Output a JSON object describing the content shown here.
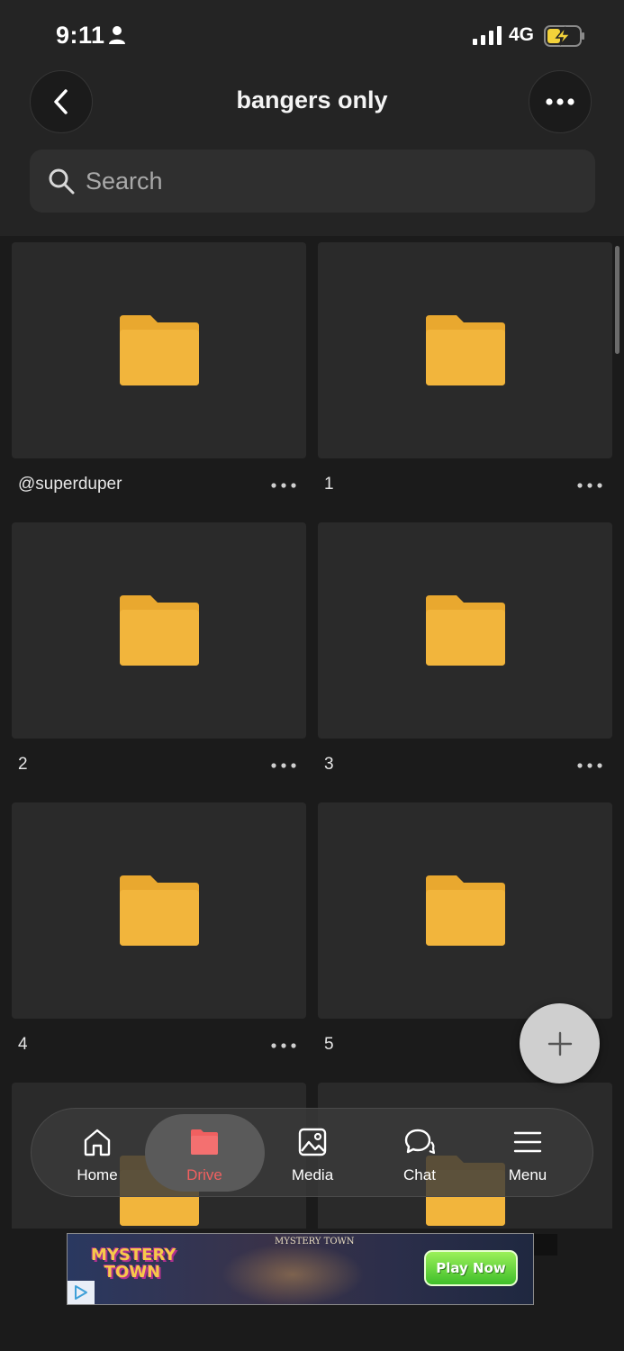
{
  "status_bar": {
    "time": "9:11",
    "network": "4G"
  },
  "header": {
    "title": "bangers only"
  },
  "search": {
    "placeholder": "Search"
  },
  "folders": [
    {
      "name": "@superduper"
    },
    {
      "name": "1"
    },
    {
      "name": "2"
    },
    {
      "name": "3"
    },
    {
      "name": "4"
    },
    {
      "name": "5"
    },
    {
      "name": ""
    },
    {
      "name": ""
    }
  ],
  "bottom_nav": {
    "items": [
      {
        "label": "Home",
        "icon": "home-icon"
      },
      {
        "label": "Drive",
        "icon": "folder-icon",
        "active": true
      },
      {
        "label": "Media",
        "icon": "image-icon"
      },
      {
        "label": "Chat",
        "icon": "chat-icon"
      },
      {
        "label": "Menu",
        "icon": "menu-icon"
      }
    ]
  },
  "ad": {
    "logo_text": "MYSTERY TOWN",
    "banner_text": "MYSTERY TOWN",
    "cta_label": "Play Now"
  },
  "colors": {
    "folder": "#f2b53c",
    "active_nav": "#f06060",
    "background": "#1b1b1b"
  }
}
